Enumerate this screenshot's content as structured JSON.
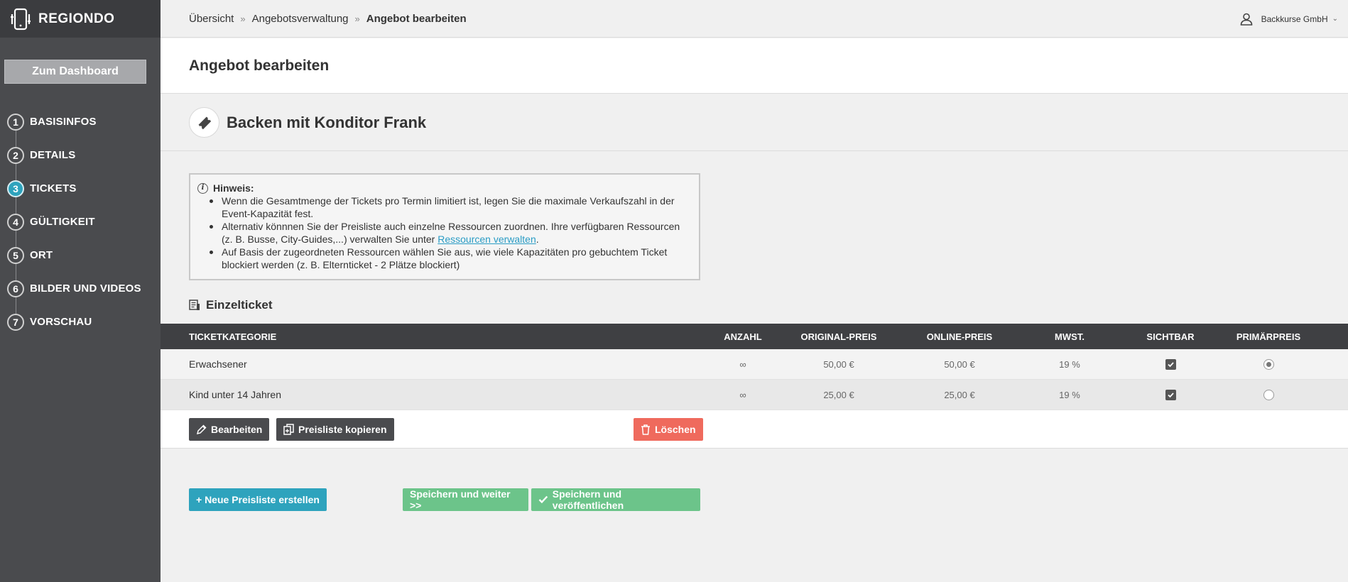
{
  "sidebar": {
    "brand": "REGIONDO",
    "dashboard_button": "Zum Dashboard",
    "steps": [
      {
        "num": "1",
        "label": "BASISINFOS"
      },
      {
        "num": "2",
        "label": "DETAILS"
      },
      {
        "num": "3",
        "label": "TICKETS"
      },
      {
        "num": "4",
        "label": "GÜLTIGKEIT"
      },
      {
        "num": "5",
        "label": "ORT"
      },
      {
        "num": "6",
        "label": "BILDER UND VIDEOS"
      },
      {
        "num": "7",
        "label": "VORSCHAU"
      }
    ],
    "active_step": 3
  },
  "breadcrumb": {
    "items": [
      "Übersicht",
      "Angebotsverwaltung",
      "Angebot bearbeiten"
    ],
    "separator": "»"
  },
  "user": {
    "name": "Backkurse GmbH"
  },
  "page_title": "Angebot bearbeiten",
  "offer_title": "Backen mit Konditor Frank",
  "hint": {
    "title": "Hinweis:",
    "items": [
      "Wenn die Gesamtmenge der Tickets pro Termin limitiert ist, legen Sie die maximale Verkaufszahl in der Event-Kapazität fest.",
      "Alternativ könnnen Sie der Preisliste auch einzelne Ressourcen zuordnen. Ihre verfügbaren Ressourcen (z. B. Busse, City-Guides,...) verwalten Sie unter ",
      "Auf Basis der zugeordneten Ressourcen wählen Sie aus, wie viele Kapazitäten pro gebuchtem Ticket blockiert werden (z. B. Elternticket - 2 Plätze blockiert)"
    ],
    "link_text": "Ressourcen verwalten",
    "link_suffix": "."
  },
  "section_title": "Einzelticket",
  "table": {
    "headers": {
      "category": "TICKETKATEGORIE",
      "count": "ANZAHL",
      "original_price": "ORIGINAL-PREIS",
      "online_price": "ONLINE-PREIS",
      "vat": "MWST.",
      "visible": "SICHTBAR",
      "primary_price": "PRIMÄRPREIS"
    },
    "rows": [
      {
        "category": "Erwachsener",
        "count": "∞",
        "original_price": "50,00 €",
        "online_price": "50,00 €",
        "vat": "19 %",
        "visible": true,
        "primary": true
      },
      {
        "category": "Kind unter 14 Jahren",
        "count": "∞",
        "original_price": "25,00 €",
        "online_price": "25,00 €",
        "vat": "19 %",
        "visible": true,
        "primary": false
      }
    ]
  },
  "actions": {
    "edit": "Bearbeiten",
    "copy": "Preisliste kopieren",
    "delete": "Löschen"
  },
  "footer": {
    "new_pricelist": "+ Neue Preisliste erstellen",
    "save_next": "Speichern und weiter >>",
    "save_publish": "Speichern und veröffentlichen"
  },
  "colors": {
    "sidebar_bg": "#4a4b4e",
    "accent_teal": "#2ea3bd",
    "danger": "#ef6a5d",
    "success": "#6cc48a",
    "table_header": "#3f4043"
  }
}
